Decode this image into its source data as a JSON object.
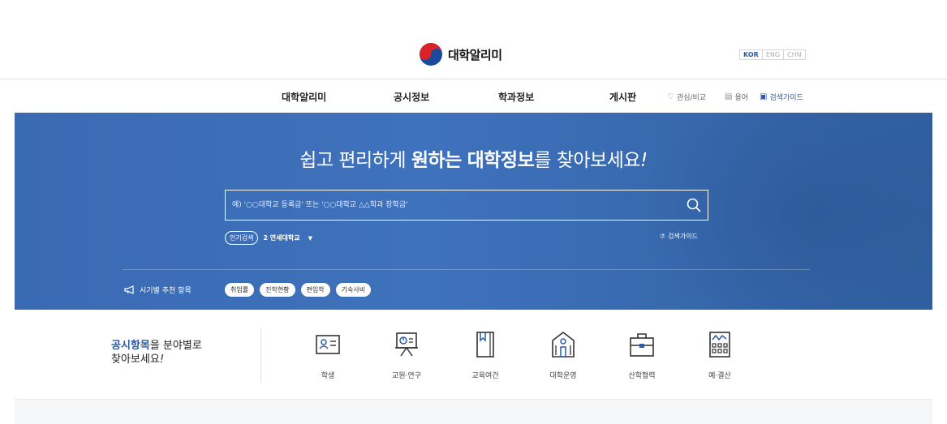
{
  "header": {
    "logo_text": "대학알리미",
    "languages": [
      "KOR",
      "ENG",
      "CHN"
    ]
  },
  "nav": {
    "items": [
      "대학알리미",
      "공시정보",
      "학과정보",
      "게시판"
    ],
    "utilities": [
      {
        "label": "관심/비교",
        "icon": "heart-icon"
      },
      {
        "label": "용어",
        "icon": "book-icon"
      },
      {
        "label": "검색가이드",
        "icon": "monitor-icon"
      }
    ]
  },
  "hero": {
    "title_part1": "쉽고 편리하게 ",
    "title_bold1": "원하는",
    "title_space": " ",
    "title_bold2": "대학정보",
    "title_part2": "를 찾아보세요",
    "title_excl": "!",
    "search_placeholder": "예) '○○대학교 등록금' 또는 '○○대학교 △△학과 장학금'",
    "popular_label": "인기검색",
    "popular_value": "2 연세대학교",
    "guide_label": "검색가이드",
    "recommend_label": "시기별 추천 항목",
    "recommend_chips": [
      "취업률",
      "진학현황",
      "편입학",
      "기숙사비"
    ]
  },
  "categories": {
    "title_bold": "공시항목",
    "title_rest": "을 분야별로",
    "title_line2": "찾아보세요",
    "title_excl": "!",
    "items": [
      {
        "label": "학생",
        "icon": "student-card-icon"
      },
      {
        "label": "교원·연구",
        "icon": "presentation-icon"
      },
      {
        "label": "교육여건",
        "icon": "book-bookmark-icon"
      },
      {
        "label": "대학운영",
        "icon": "building-icon"
      },
      {
        "label": "산학협력",
        "icon": "briefcase-icon"
      },
      {
        "label": "예·결산",
        "icon": "calculator-icon"
      }
    ]
  },
  "colors": {
    "brand_blue": "#2a5aa8",
    "hero_blue": "#3f72bd",
    "logo_red": "#d8232a",
    "logo_blue": "#1b4a9c"
  }
}
